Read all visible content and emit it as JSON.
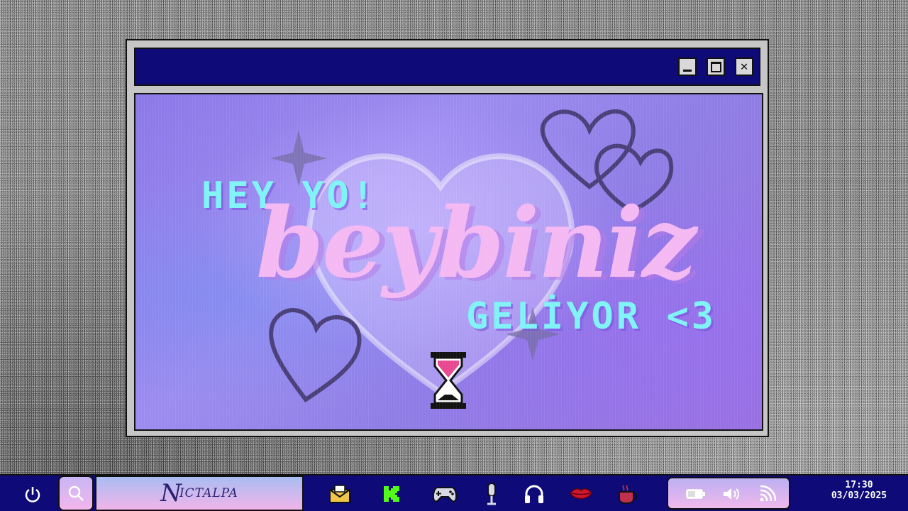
{
  "window": {
    "buttons": {
      "minimize": "minimize",
      "maximize": "maximize",
      "close": "close"
    },
    "content": {
      "line1": "HEY YO!",
      "line2": "beybiniz",
      "line3": "GELİYOR <3"
    }
  },
  "taskbar": {
    "brand_initial": "N",
    "brand_rest": "ICTALPA",
    "apps": [
      "mail-icon",
      "kick-icon",
      "gamepad-icon",
      "microphone-icon",
      "headphones-icon",
      "lips-icon",
      "coffee-icon"
    ],
    "tray": [
      "battery-icon",
      "volume-icon",
      "wifi-icon"
    ],
    "clock": {
      "time": "17:30",
      "date": "03/03/2025"
    }
  },
  "colors": {
    "titlebar": "#0e0a78",
    "accent_cyan": "#7ff3f6",
    "accent_pink": "#f4b8f2",
    "content_purple": "#8c78e8"
  }
}
